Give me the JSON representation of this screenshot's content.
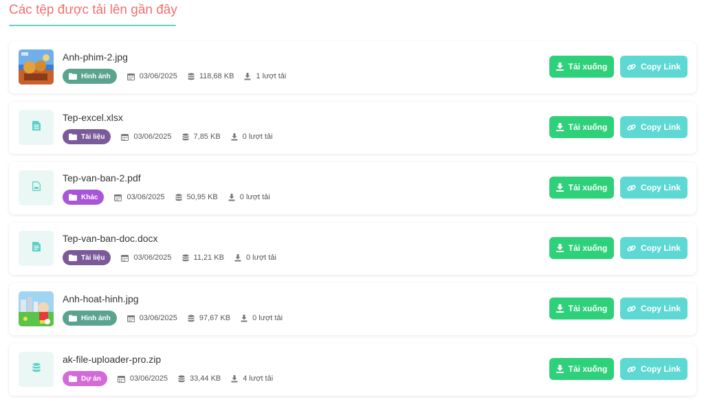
{
  "page": {
    "title": "Các tệp được tải lên gần đây"
  },
  "colors": {
    "title": "#f0706e",
    "underline": "#5fcfc6",
    "download_button": "#2ed07a",
    "copy_button": "#5ed8d2",
    "badge_image": "#5aa38e",
    "badge_document": "#7b5a9a",
    "badge_other": "#a855d8",
    "badge_project": "#d46ad8"
  },
  "actions": {
    "download_label": "Tải xuống",
    "copy_label": "Copy Link"
  },
  "files": [
    {
      "name": "Anh-phim-2.jpg",
      "category": "Hình ảnh",
      "date": "03/06/2025",
      "size": "118,68 KB",
      "downloads": "1 lượt tải",
      "thumb": "image"
    },
    {
      "name": "Tep-excel.xlsx",
      "category": "Tài liệu",
      "date": "03/06/2025",
      "size": "7,85 KB",
      "downloads": "0 lượt tải",
      "thumb": "spreadsheet-icon"
    },
    {
      "name": "Tep-van-ban-2.pdf",
      "category": "Khác",
      "date": "03/06/2025",
      "size": "50,95 KB",
      "downloads": "0 lượt tải",
      "thumb": "pdf-file-icon"
    },
    {
      "name": "Tep-van-ban-doc.docx",
      "category": "Tài liệu",
      "date": "03/06/2025",
      "size": "11,21 KB",
      "downloads": "0 lượt tải",
      "thumb": "document-icon"
    },
    {
      "name": "Anh-hoat-hinh.jpg",
      "category": "Hình ảnh",
      "date": "03/06/2025",
      "size": "97,67 KB",
      "downloads": "0 lượt tải",
      "thumb": "image"
    },
    {
      "name": "ak-file-uploader-pro.zip",
      "category": "Dự án",
      "date": "03/06/2025",
      "size": "33,44 KB",
      "downloads": "4 lượt tải",
      "thumb": "database-icon"
    }
  ]
}
